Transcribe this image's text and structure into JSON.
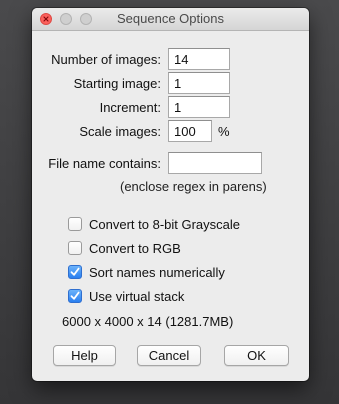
{
  "window": {
    "title": "Sequence Options"
  },
  "fields": {
    "number_of_images": {
      "label": "Number of images:",
      "value": "14"
    },
    "starting_image": {
      "label": "Starting image:",
      "value": "1"
    },
    "increment": {
      "label": "Increment:",
      "value": "1"
    },
    "scale_images": {
      "label": "Scale images:",
      "value": "100",
      "unit": "%"
    },
    "file_name_contains": {
      "label": "File name contains:",
      "value": ""
    }
  },
  "hint": "(enclose regex in parens)",
  "options": [
    {
      "label": "Convert to 8-bit Grayscale",
      "checked": false
    },
    {
      "label": "Convert to RGB",
      "checked": false
    },
    {
      "label": "Sort names numerically",
      "checked": true
    },
    {
      "label": "Use virtual stack",
      "checked": true
    }
  ],
  "summary": "6000 x 4000 x 14 (1281.7MB)",
  "buttons": {
    "help": "Help",
    "cancel": "Cancel",
    "ok": "OK"
  },
  "colors": {
    "close_button": "#fc605c",
    "checkbox_checked": "#2a7ff0",
    "dialog_background": "#ececec"
  }
}
